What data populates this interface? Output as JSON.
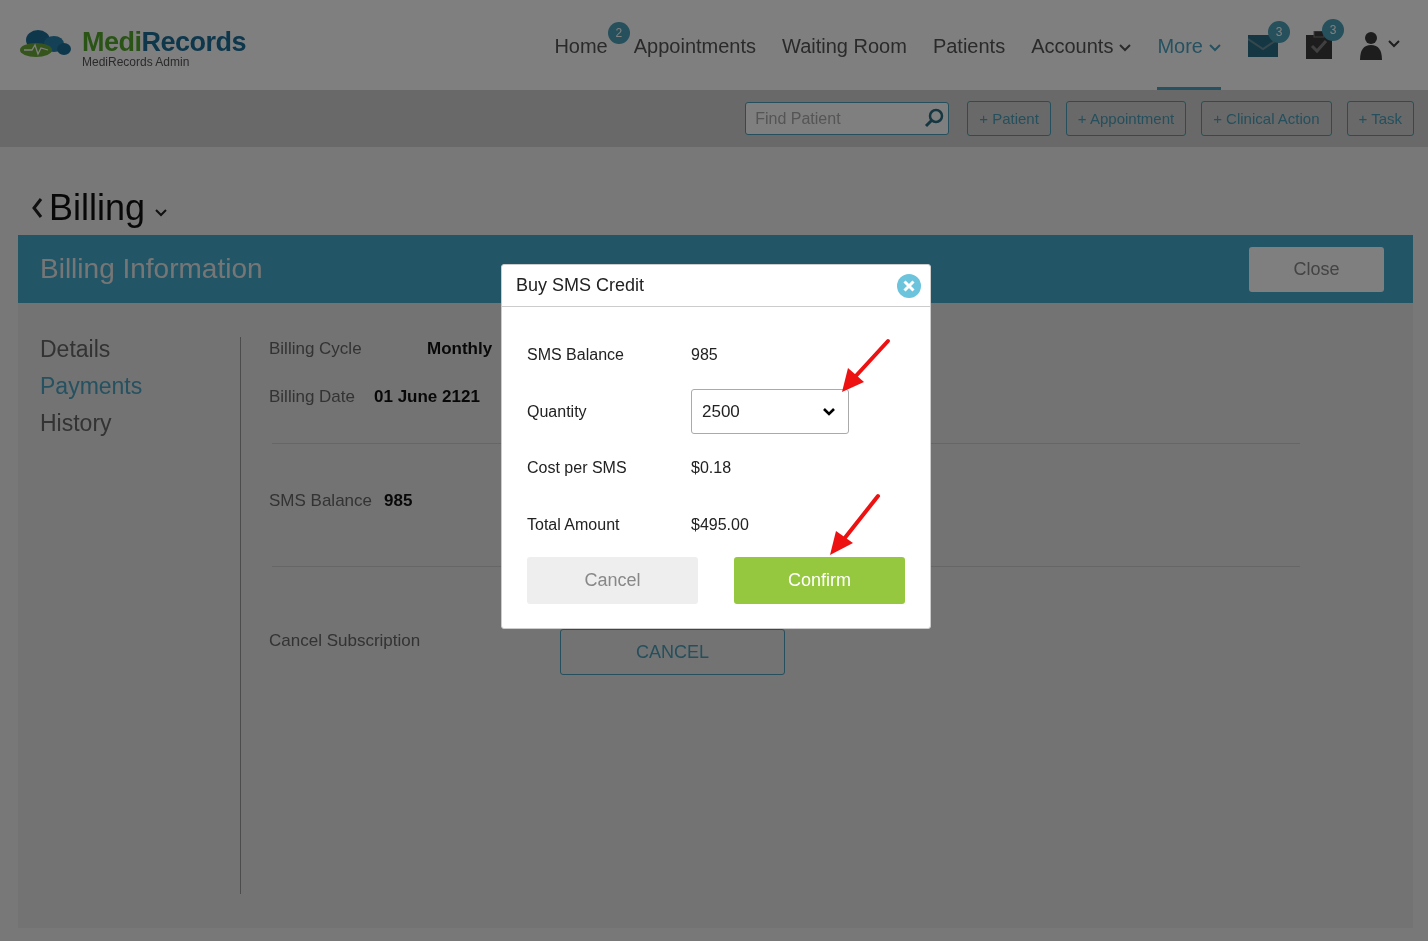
{
  "logo": {
    "part_1": "Medi",
    "part_2": "Records",
    "subtitle": "MediRecords Admin"
  },
  "nav": [
    {
      "label": "Home",
      "selected": false,
      "dropdown": false,
      "badge": "2"
    },
    {
      "label": "Appointments",
      "selected": false,
      "dropdown": false
    },
    {
      "label": "Waiting Room",
      "selected": false,
      "dropdown": false
    },
    {
      "label": "Patients",
      "selected": false,
      "dropdown": false
    },
    {
      "label": "Accounts",
      "selected": false,
      "dropdown": true
    },
    {
      "label": "More",
      "selected": true,
      "dropdown": true
    }
  ],
  "nav_icons": [
    {
      "kind": "mail",
      "badge": "3"
    },
    {
      "kind": "tasks",
      "badge": "3"
    },
    {
      "kind": "user"
    }
  ],
  "toolbar": {
    "search": {
      "placeholder": "Find Patient"
    },
    "buttons": [
      "+ Patient",
      "+ Appointment",
      "+ Clinical Action",
      "+ Task"
    ]
  },
  "page_title": "Billing",
  "panel": {
    "title": "Billing Information",
    "close_button": "Close"
  },
  "sidebar": [
    {
      "label": "Details",
      "selected": false
    },
    {
      "label": "Payments",
      "selected": true
    },
    {
      "label": "History",
      "selected": false
    }
  ],
  "fields": {
    "billing_cycle": {
      "label": "Billing Cycle",
      "value": "Monthly"
    },
    "billing_date": {
      "label": "Billing Date",
      "value": "01 June 2121"
    },
    "sms_balance": {
      "label": "SMS Balance",
      "value": "985"
    },
    "cancel_subscription": {
      "label": "Cancel Subscription",
      "button": "CANCEL"
    }
  },
  "dialog": {
    "title": "Buy SMS Credit",
    "rows": [
      {
        "kind": "text",
        "label": "SMS Balance",
        "value": "985"
      },
      {
        "kind": "select",
        "label": "Quantity",
        "value": "2500"
      },
      {
        "kind": "text",
        "label": "Cost per SMS",
        "value": "$0.18"
      },
      {
        "kind": "text",
        "label": "Total Amount",
        "value": "$495.00"
      }
    ],
    "cancel_button": "Cancel",
    "confirm_button": "Confirm"
  }
}
